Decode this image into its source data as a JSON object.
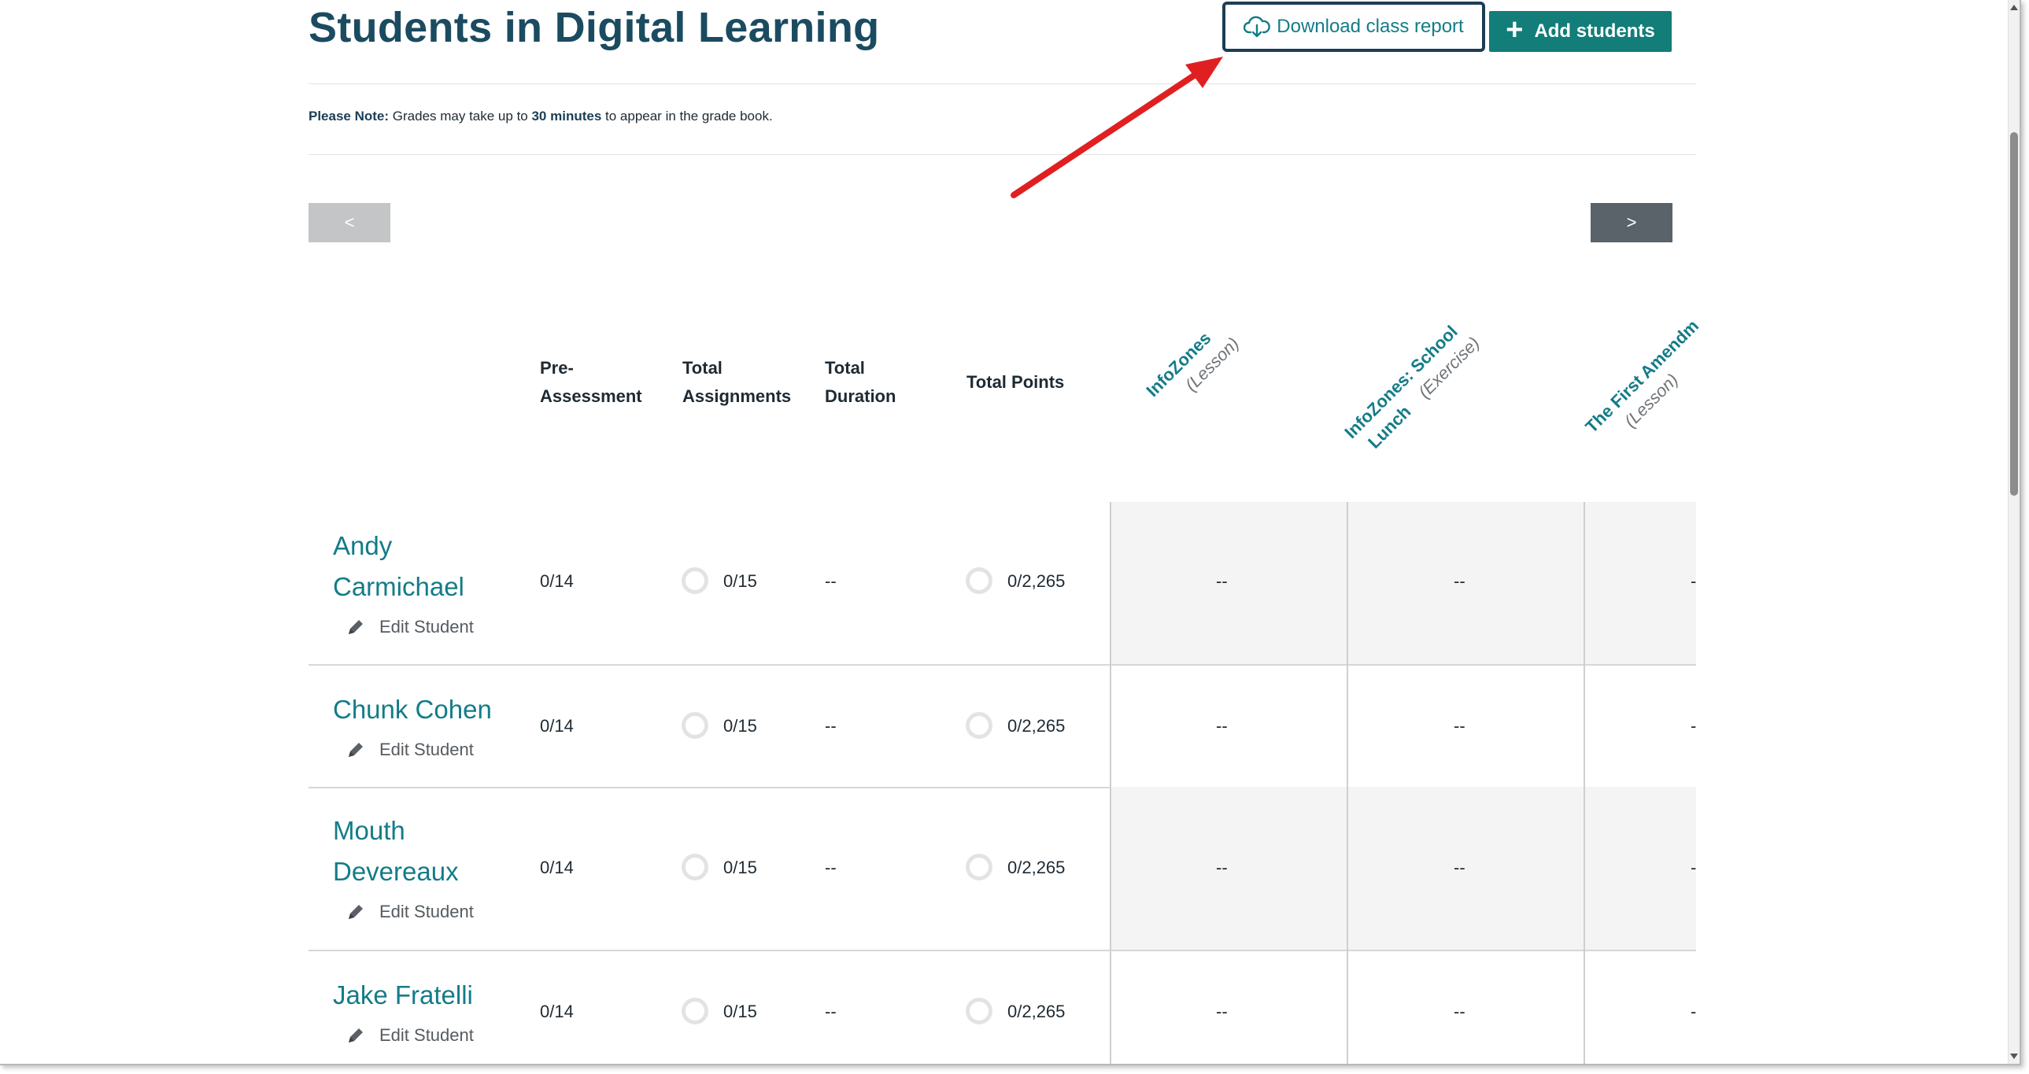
{
  "header": {
    "title": "Students in Digital Learning",
    "download_label": "Download class report",
    "add_label": "Add students"
  },
  "note": {
    "prefix": "Please Note:",
    "text1": " Grades may take up to ",
    "emphasis": "30 minutes",
    "text2": " to appear in the grade book."
  },
  "pager": {
    "prev": "<",
    "next": ">"
  },
  "columns": {
    "pre_assessment": [
      "Pre-",
      "Assessment"
    ],
    "total_assignments": [
      "Total",
      "Assignments"
    ],
    "total_duration": [
      "Total",
      "Duration"
    ],
    "total_points": "Total Points"
  },
  "activities": [
    {
      "title": "InfoZones",
      "type": "(Lesson)"
    },
    {
      "title": "InfoZones: School",
      "title2": "Lunch",
      "type": "(Exercise)"
    },
    {
      "title": "The First Amendm",
      "type": "(Lesson)"
    }
  ],
  "edit_label": "Edit Student",
  "students": [
    {
      "name1": "Andy",
      "name2": "Carmichael",
      "pre": "0/14",
      "assignments": "0/15",
      "duration": "--",
      "points": "0/2,265",
      "a1": "--",
      "a2": "--",
      "a3": "-"
    },
    {
      "name1": "Chunk Cohen",
      "name2": "",
      "pre": "0/14",
      "assignments": "0/15",
      "duration": "--",
      "points": "0/2,265",
      "a1": "--",
      "a2": "--",
      "a3": "-"
    },
    {
      "name1": "Mouth",
      "name2": "Devereaux",
      "pre": "0/14",
      "assignments": "0/15",
      "duration": "--",
      "points": "0/2,265",
      "a1": "--",
      "a2": "--",
      "a3": "-"
    },
    {
      "name1": "Jake Fratelli",
      "name2": "",
      "pre": "0/14",
      "assignments": "0/15",
      "duration": "--",
      "points": "0/2,265",
      "a1": "--",
      "a2": "--",
      "a3": "-"
    }
  ],
  "colors": {
    "accent": "#127d79",
    "link": "#137c88",
    "title": "#1b4b60",
    "annotation": "#e02020"
  }
}
